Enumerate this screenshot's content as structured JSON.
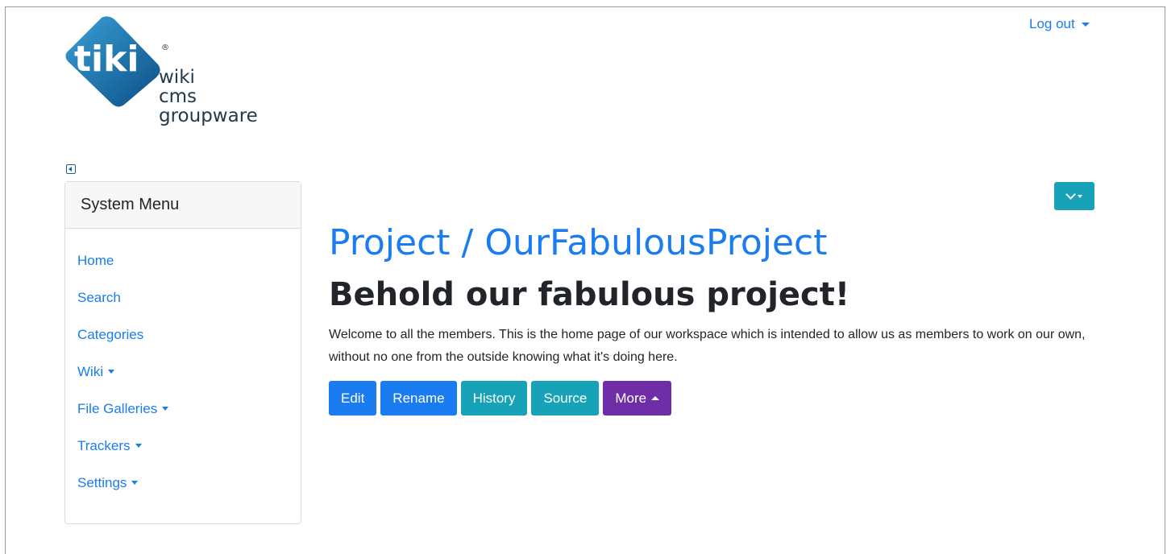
{
  "header": {
    "logo_tagline": [
      "wiki",
      "cms",
      "groupware"
    ],
    "logout_label": "Log out"
  },
  "sidebar": {
    "title": "System Menu",
    "items": [
      {
        "label": "Home",
        "has_dropdown": false
      },
      {
        "label": "Search",
        "has_dropdown": false
      },
      {
        "label": "Categories",
        "has_dropdown": false
      },
      {
        "label": "Wiki",
        "has_dropdown": true
      },
      {
        "label": "File Galleries",
        "has_dropdown": true
      },
      {
        "label": "Trackers",
        "has_dropdown": true
      },
      {
        "label": "Settings",
        "has_dropdown": true
      }
    ]
  },
  "main": {
    "breadcrumb_title": "Project / OurFabulousProject",
    "heading": "Behold our fabulous project!",
    "intro": "Welcome to all the members. This is the home page of our workspace which is intended to allow us as members to work on our own, without no one from the outside knowing what it's doing here.",
    "buttons": [
      {
        "label": "Edit",
        "style": "blue"
      },
      {
        "label": "Rename",
        "style": "blue"
      },
      {
        "label": "History",
        "style": "teal"
      },
      {
        "label": "Source",
        "style": "teal"
      },
      {
        "label": "More",
        "style": "purple"
      }
    ]
  },
  "colors": {
    "link": "#1a7cf0",
    "primary": "#1a7cf0",
    "info": "#17a2b8",
    "purple": "#6f2da8"
  },
  "icons": [
    "tiki-logo",
    "collapse-sidebar-icon",
    "chevron-down-icon",
    "caret-down-icon",
    "caret-up-icon"
  ]
}
